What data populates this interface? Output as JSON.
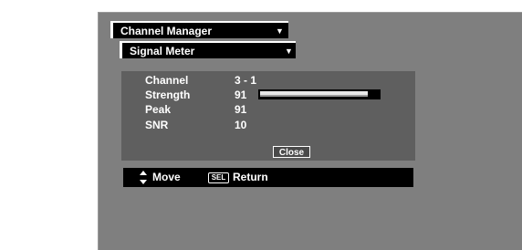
{
  "menu": {
    "channel_manager_label": "Channel Manager",
    "signal_meter_label": "Signal Meter",
    "dropdown_arrow": "▼"
  },
  "meter": {
    "rows": [
      {
        "label": "Channel",
        "value": "3 - 1"
      },
      {
        "label": "Strength",
        "value": "91"
      },
      {
        "label": "Peak",
        "value": "91"
      },
      {
        "label": "SNR",
        "value": "10"
      }
    ],
    "strength_level_percent": 91,
    "close_label": "Close"
  },
  "help": {
    "move_label": "Move",
    "sel_key": "SEL",
    "return_label": "Return"
  },
  "colors": {
    "panel": "#7f7f7f",
    "meter_box": "#5f5f5f",
    "bar_track": "#000000",
    "bar_fill": "#e8e8e8"
  }
}
